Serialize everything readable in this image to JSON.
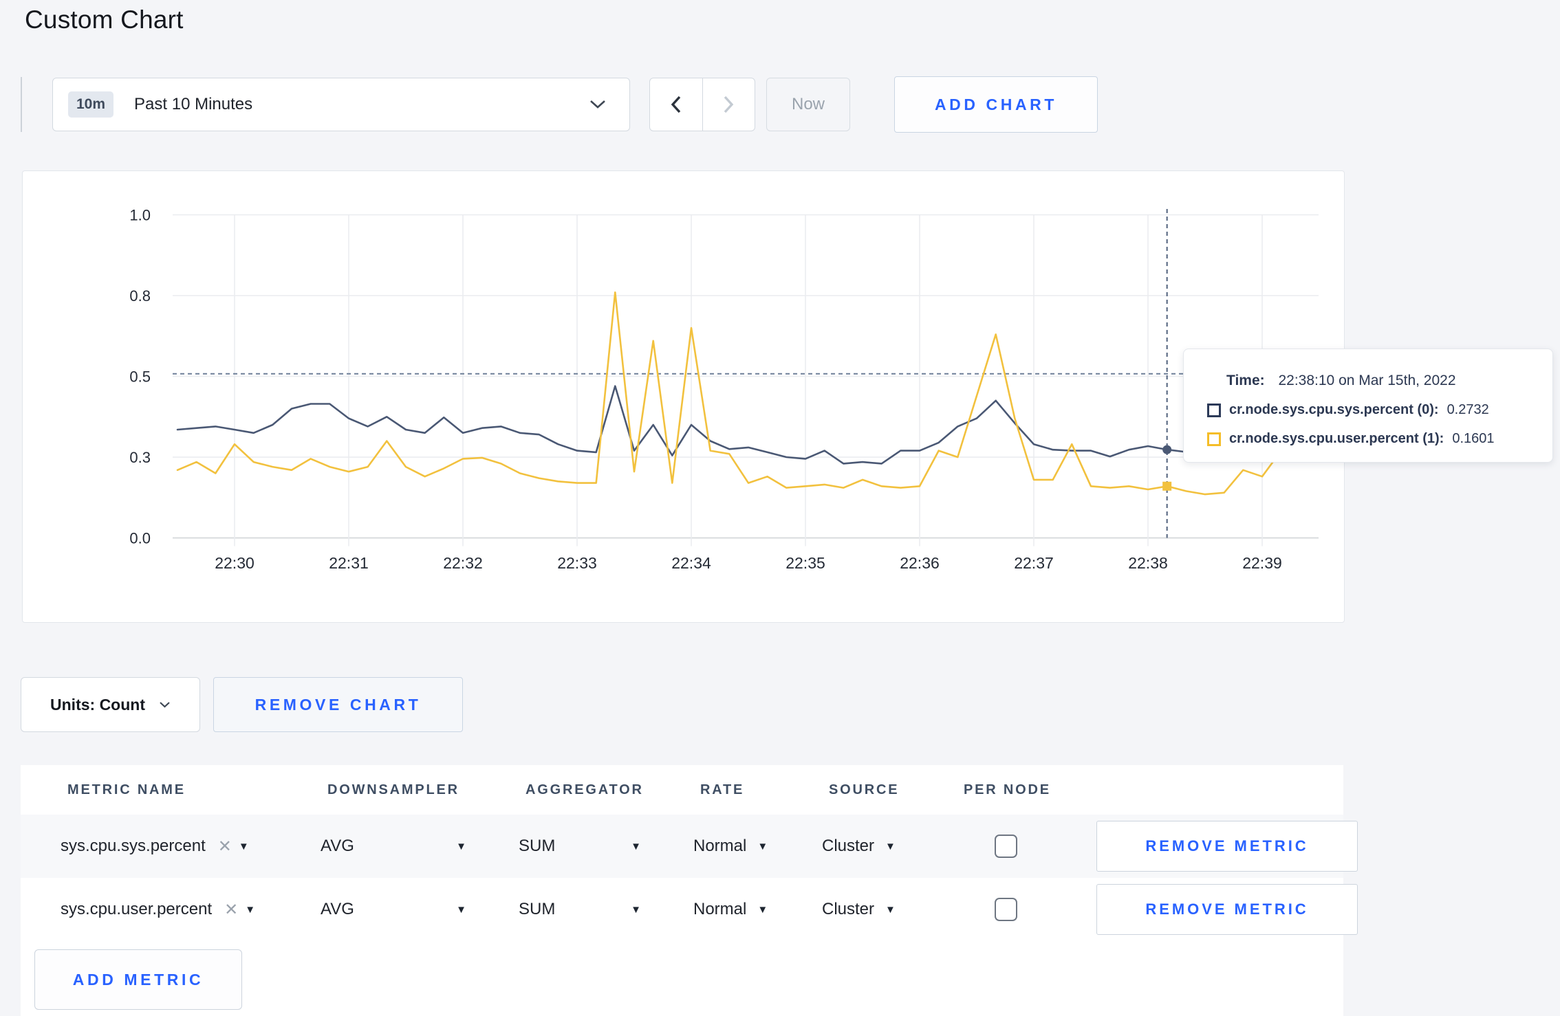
{
  "page": {
    "title": "Custom Chart"
  },
  "toolbar": {
    "time_scale_badge": "10m",
    "time_scale_label": "Past 10 Minutes",
    "now_label": "Now",
    "add_chart_label": "ADD CHART"
  },
  "chart_data": {
    "type": "line",
    "title": "",
    "xlabel": "",
    "ylabel": "",
    "ylim": [
      0,
      1
    ],
    "grid": true,
    "y_tick_values": [
      0,
      0.25,
      0.5,
      0.75,
      1.0
    ],
    "y_tick_labels": [
      "0.0",
      "0.3",
      "0.5",
      "0.8",
      "1.0"
    ],
    "x_ticks": [
      "22:30",
      "22:31",
      "22:32",
      "22:33",
      "22:34",
      "22:35",
      "22:36",
      "22:37",
      "22:38",
      "22:39"
    ],
    "x_start": "22:29:30",
    "x_interval_seconds": 10,
    "series": [
      {
        "name": "cr.node.sys.cpu.sys.percent",
        "color": "#4a5874",
        "values": [
          0.335,
          0.34,
          0.345,
          0.335,
          0.325,
          0.35,
          0.4,
          0.415,
          0.415,
          0.37,
          0.345,
          0.375,
          0.335,
          0.325,
          0.373,
          0.325,
          0.34,
          0.345,
          0.325,
          0.32,
          0.29,
          0.27,
          0.265,
          0.47,
          0.27,
          0.35,
          0.255,
          0.35,
          0.3,
          0.275,
          0.28,
          0.265,
          0.25,
          0.245,
          0.27,
          0.23,
          0.235,
          0.23,
          0.27,
          0.27,
          0.295,
          0.345,
          0.37,
          0.425,
          0.355,
          0.29,
          0.273,
          0.27,
          0.27,
          0.252,
          0.273,
          0.284,
          0.2732,
          0.266,
          0.25,
          0.27,
          0.3,
          0.31,
          0.295,
          0.305
        ]
      },
      {
        "name": "cr.node.sys.cpu.user.percent",
        "color": "#f2c13e",
        "values": [
          0.21,
          0.235,
          0.2,
          0.29,
          0.235,
          0.22,
          0.21,
          0.245,
          0.22,
          0.205,
          0.22,
          0.3,
          0.22,
          0.19,
          0.215,
          0.245,
          0.248,
          0.23,
          0.2,
          0.185,
          0.175,
          0.17,
          0.17,
          0.76,
          0.205,
          0.61,
          0.17,
          0.65,
          0.27,
          0.26,
          0.17,
          0.19,
          0.155,
          0.16,
          0.165,
          0.155,
          0.18,
          0.16,
          0.155,
          0.16,
          0.27,
          0.25,
          0.44,
          0.63,
          0.37,
          0.18,
          0.18,
          0.29,
          0.16,
          0.155,
          0.16,
          0.15,
          0.1601,
          0.145,
          0.135,
          0.14,
          0.21,
          0.19,
          0.27,
          0.24
        ]
      }
    ],
    "crosshair": {
      "time": "22:38:10",
      "hline_value": 0.508,
      "points": [
        {
          "series": 0,
          "value": 0.2732
        },
        {
          "series": 1,
          "value": 0.1601
        }
      ]
    }
  },
  "tooltip": {
    "time_label": "Time:",
    "time_value": "22:38:10 on Mar 15th, 2022",
    "rows": [
      {
        "label": "cr.node.sys.cpu.sys.percent (0):",
        "value": "0.2732",
        "color": "#2c3a58"
      },
      {
        "label": "cr.node.sys.cpu.user.percent (1):",
        "value": "0.1601",
        "color": "#f5bd27"
      }
    ]
  },
  "chart_actions": {
    "units_label": "Units: Count",
    "remove_chart_label": "REMOVE CHART"
  },
  "metrics_table": {
    "headers": [
      "METRIC NAME",
      "DOWNSAMPLER",
      "AGGREGATOR",
      "RATE",
      "SOURCE",
      "PER NODE"
    ],
    "rows": [
      {
        "metric": "sys.cpu.sys.percent",
        "downsampler": "AVG",
        "aggregator": "SUM",
        "rate": "Normal",
        "source": "Cluster",
        "per_node_checked": false
      },
      {
        "metric": "sys.cpu.user.percent",
        "downsampler": "AVG",
        "aggregator": "SUM",
        "rate": "Normal",
        "source": "Cluster",
        "per_node_checked": false
      }
    ],
    "remove_metric_label": "REMOVE METRIC",
    "add_metric_label": "ADD METRIC"
  },
  "colors": {
    "accent_blue": "#2962ff",
    "sys_series": "#4a5874",
    "user_series": "#f2c13e"
  }
}
